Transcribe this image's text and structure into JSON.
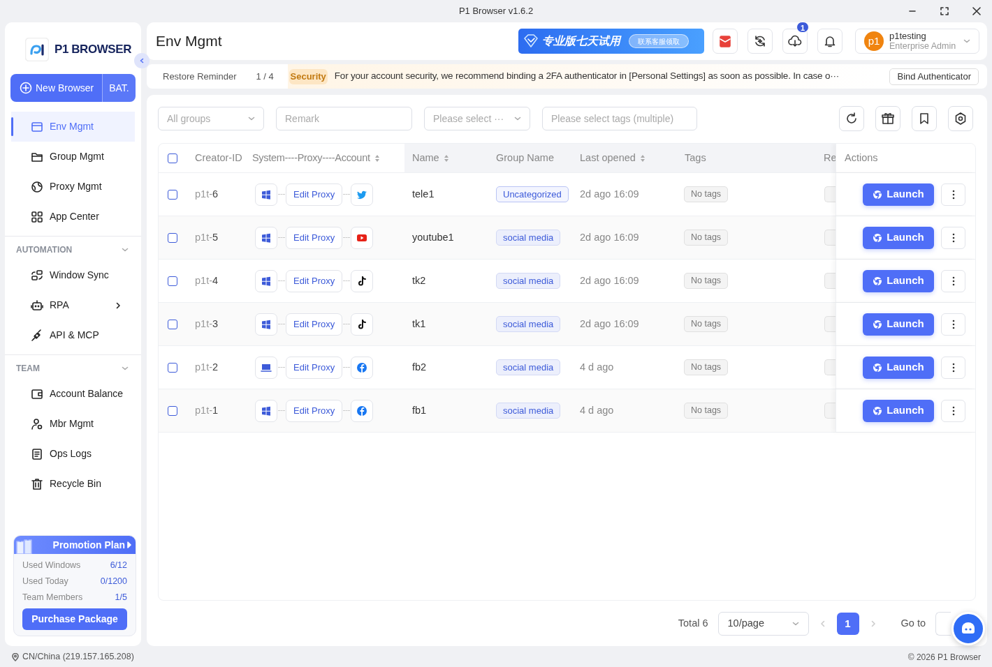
{
  "window": {
    "title": "P1 Browser v1.6.2"
  },
  "sidebar": {
    "logo_text": "P1 BROWSER",
    "new_browser": "New Browser",
    "batch": "BAT.",
    "nav": [
      {
        "label": "Env Mgmt",
        "kind": "env",
        "selected": true,
        "has_submenu": false
      },
      {
        "label": "Group Mgmt",
        "kind": "folder",
        "selected": false,
        "has_submenu": false
      },
      {
        "label": "Proxy Mgmt",
        "kind": "globe",
        "selected": false,
        "has_submenu": false
      },
      {
        "label": "App Center",
        "kind": "apps",
        "selected": false,
        "has_submenu": false
      }
    ],
    "sections": [
      {
        "title": "AUTOMATION",
        "expanded": true,
        "items": [
          {
            "label": "Window Sync",
            "kind": "sync",
            "selected": false,
            "has_submenu": false
          },
          {
            "label": "RPA",
            "kind": "robot",
            "selected": false,
            "has_submenu": true
          },
          {
            "label": "API & MCP",
            "kind": "plug",
            "selected": false,
            "has_submenu": false
          }
        ]
      },
      {
        "title": "TEAM",
        "expanded": true,
        "items": [
          {
            "label": "Account Balance",
            "kind": "wallet",
            "selected": false,
            "has_submenu": false
          },
          {
            "label": "Mbr Mgmt",
            "kind": "member",
            "selected": false,
            "has_submenu": false
          },
          {
            "label": "Ops Logs",
            "kind": "log",
            "selected": false,
            "has_submenu": false
          },
          {
            "label": "Recycle Bin",
            "kind": "trash",
            "selected": false,
            "has_submenu": false
          }
        ]
      }
    ],
    "promo": {
      "title": "Promotion Plan",
      "stats": [
        {
          "label": "Used Windows",
          "value": "6/12"
        },
        {
          "label": "Used Today",
          "value": "0/1200"
        },
        {
          "label": "Team Members",
          "value": "1/5"
        }
      ],
      "button": "Purchase Package"
    }
  },
  "header": {
    "title": "Env Mgmt",
    "promo_title": "专业版七天试用",
    "promo_button": "联系客服领取",
    "download_badge": "1",
    "user": {
      "avatar": "p1",
      "name": "p1testing",
      "role": "Enterprise Admin"
    }
  },
  "notice": {
    "label": "Restore Reminder",
    "pager": "1 / 4",
    "tag": "Security",
    "message": "For your account security, we recommend binding a 2FA authenticator in [Personal Settings] as soon as possible. In case o···",
    "button": "Bind Authenticator"
  },
  "filters": [
    {
      "kind": "select",
      "placeholder": "All groups"
    },
    {
      "kind": "input",
      "placeholder": "Remark"
    },
    {
      "kind": "select",
      "placeholder": "Please select ···"
    },
    {
      "kind": "input",
      "placeholder": "Please select tags (multiple)"
    }
  ],
  "table": {
    "all_checked": false,
    "columns": [
      {
        "label": "Creator-ID",
        "sortable": false
      },
      {
        "label": "System----Proxy----Account",
        "sortable": true
      },
      {
        "label": "Name",
        "sortable": true
      },
      {
        "label": "Group Name",
        "sortable": false
      },
      {
        "label": "Last opened",
        "sortable": true
      },
      {
        "label": "Tags",
        "sortable": false
      },
      {
        "label": "Re"
      },
      {
        "label": "Actions",
        "sortable": false
      }
    ],
    "rows": [
      {
        "id_prefix": "p1t-",
        "id_number": "6",
        "system": {
          "kind": "windows"
        },
        "proxy": "Edit Proxy",
        "account": {
          "kind": "twitter"
        },
        "name": "tele1",
        "group": {
          "label": "Uncategorized",
          "kind": "default"
        },
        "last_opened": "2d ago 16:09",
        "tags": "No tags",
        "launch": "Launch",
        "checked": false
      },
      {
        "id_prefix": "p1t-",
        "id_number": "5",
        "system": {
          "kind": "windows"
        },
        "proxy": "Edit Proxy",
        "account": {
          "kind": "youtube"
        },
        "name": "youtube1",
        "group": {
          "label": "social media",
          "kind": "custom"
        },
        "last_opened": "2d ago 16:09",
        "tags": "No tags",
        "launch": "Launch",
        "checked": false
      },
      {
        "id_prefix": "p1t-",
        "id_number": "4",
        "system": {
          "kind": "windows"
        },
        "proxy": "Edit Proxy",
        "account": {
          "kind": "tiktok"
        },
        "name": "tk2",
        "group": {
          "label": "social media",
          "kind": "custom"
        },
        "last_opened": "2d ago 16:09",
        "tags": "No tags",
        "launch": "Launch",
        "checked": false
      },
      {
        "id_prefix": "p1t-",
        "id_number": "3",
        "system": {
          "kind": "windows"
        },
        "proxy": "Edit Proxy",
        "account": {
          "kind": "tiktok"
        },
        "name": "tk1",
        "group": {
          "label": "social media",
          "kind": "custom"
        },
        "last_opened": "2d ago 16:09",
        "tags": "No tags",
        "launch": "Launch",
        "checked": false
      },
      {
        "id_prefix": "p1t-",
        "id_number": "2",
        "system": {
          "kind": "laptop"
        },
        "proxy": "Edit Proxy",
        "account": {
          "kind": "facebook"
        },
        "name": "fb2",
        "group": {
          "label": "social media",
          "kind": "custom"
        },
        "last_opened": "4 d ago",
        "tags": "No tags",
        "launch": "Launch",
        "checked": false
      },
      {
        "id_prefix": "p1t-",
        "id_number": "1",
        "system": {
          "kind": "windows"
        },
        "proxy": "Edit Proxy",
        "account": {
          "kind": "facebook"
        },
        "name": "fb1",
        "group": {
          "label": "social media",
          "kind": "custom"
        },
        "last_opened": "4 d ago",
        "tags": "No tags",
        "launch": "Launch",
        "checked": false
      }
    ]
  },
  "pagination": {
    "total": "Total 6",
    "page_size": "10/page",
    "pages": [
      {
        "label": "1",
        "selected": true
      }
    ],
    "goto": "Go to"
  },
  "status_bar": {
    "location": "CN/China (219.157.165.208)",
    "copyright": "© 2026 P1 Browser"
  }
}
